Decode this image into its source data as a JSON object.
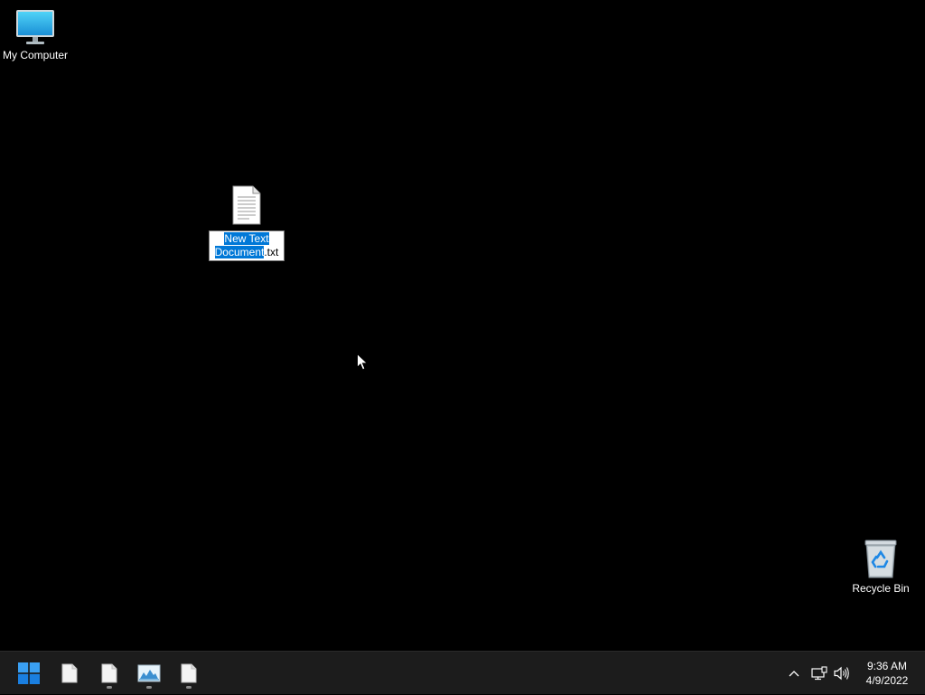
{
  "desktop": {
    "icons": [
      {
        "label": "My Computer",
        "icon": "monitor-icon"
      },
      {
        "label": "Recycle Bin",
        "icon": "recycle-bin-icon"
      }
    ],
    "renaming_file": {
      "icon": "text-document-icon",
      "selected_name_line1": "New Text",
      "selected_name_line2": "Document",
      "extension": ".txt"
    }
  },
  "taskbar": {
    "start_icon": "windows-logo-icon",
    "apps": [
      {
        "icon": "document-icon",
        "running": false
      },
      {
        "icon": "document-icon",
        "running": true
      },
      {
        "icon": "image-viewer-icon",
        "running": true
      },
      {
        "icon": "document-icon",
        "running": true
      }
    ],
    "tray": {
      "chevron_icon": "chevron-up-icon",
      "network_icon": "network-icon",
      "volume_icon": "volume-icon"
    },
    "clock": {
      "time": "9:36 AM",
      "date": "4/9/2022"
    }
  },
  "colors": {
    "desktop_background": "#000000",
    "taskbar_background": "#1c1c1c",
    "selection": "#0078d7"
  }
}
